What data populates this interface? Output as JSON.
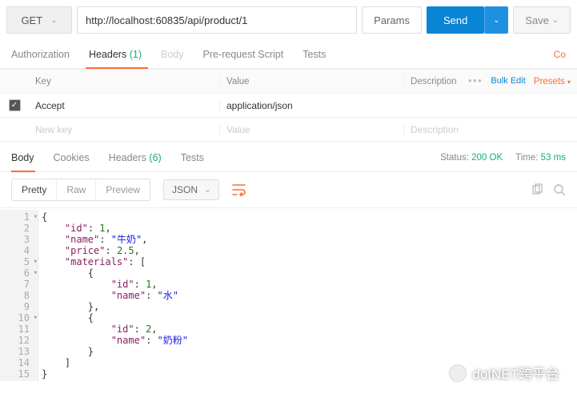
{
  "top": {
    "method": "GET",
    "url": "http://localhost:60835/api/product/1",
    "params": "Params",
    "send": "Send",
    "save": "Save"
  },
  "reqTabs": {
    "auth": "Authorization",
    "headers": "Headers",
    "headersCount": "(1)",
    "body": "Body",
    "prereq": "Pre-request Script",
    "tests": "Tests",
    "cookies": "Co"
  },
  "headTable": {
    "key": "Key",
    "value": "Value",
    "desc": "Description",
    "bulk": "Bulk Edit",
    "presets": "Presets",
    "row1": {
      "k": "Accept",
      "v": "application/json"
    },
    "ph": {
      "k": "New key",
      "v": "Value",
      "d": "Description"
    }
  },
  "respTabs": {
    "body": "Body",
    "cookies": "Cookies",
    "headers": "Headers",
    "headersCount": "(6)",
    "tests": "Tests",
    "statusL": "Status:",
    "statusV": "200 OK",
    "timeL": "Time:",
    "timeV": "53 ms"
  },
  "viewbar": {
    "pretty": "Pretty",
    "raw": "Raw",
    "preview": "Preview",
    "fmt": "JSON"
  },
  "json": {
    "l1": "{",
    "l2a": "\"id\"",
    "l2b": ": ",
    "l2c": "1",
    "l2d": ",",
    "l3a": "\"name\"",
    "l3b": ": ",
    "l3c": "\"牛奶\"",
    "l3d": ",",
    "l4a": "\"price\"",
    "l4b": ": ",
    "l4c": "2.5",
    "l4d": ",",
    "l5a": "\"materials\"",
    "l5b": ": [",
    "l6": "{",
    "l7a": "\"id\"",
    "l7b": ": ",
    "l7c": "1",
    "l7d": ",",
    "l8a": "\"name\"",
    "l8b": ": ",
    "l8c": "\"水\"",
    "l9": "},",
    "l10": "{",
    "l11a": "\"id\"",
    "l11b": ": ",
    "l11c": "2",
    "l11d": ",",
    "l12a": "\"name\"",
    "l12b": ": ",
    "l12c": "\"奶粉\"",
    "l13": "}",
    "l14": "]",
    "l15": "}"
  },
  "watermark": "dotNET跨平台"
}
